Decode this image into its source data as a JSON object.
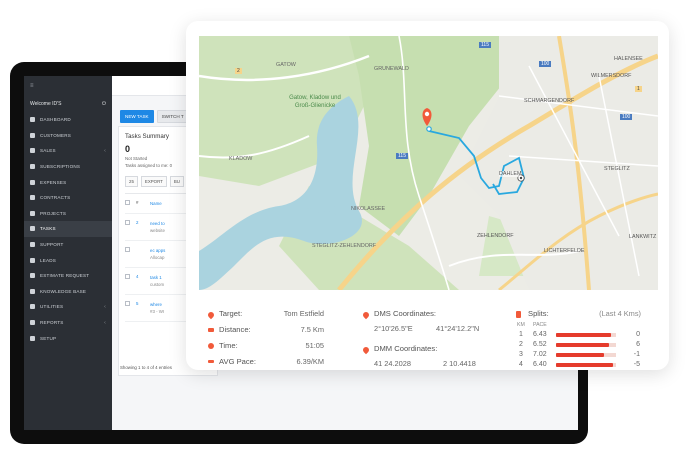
{
  "app": {
    "sidebar": {
      "user": "Welcome ID'S",
      "items": [
        {
          "label": "Dashboard",
          "chevron": false
        },
        {
          "label": "Customers",
          "chevron": false
        },
        {
          "label": "Sales",
          "chevron": true
        },
        {
          "label": "Subscriptions",
          "chevron": false
        },
        {
          "label": "Expenses",
          "chevron": false
        },
        {
          "label": "Contracts",
          "chevron": false
        },
        {
          "label": "Projects",
          "chevron": false
        },
        {
          "label": "Tasks",
          "chevron": false,
          "active": true
        },
        {
          "label": "Support",
          "chevron": false
        },
        {
          "label": "Leads",
          "chevron": false
        },
        {
          "label": "Estimate Request",
          "chevron": false
        },
        {
          "label": "Knowledge Base",
          "chevron": false
        },
        {
          "label": "Utilities",
          "chevron": true
        },
        {
          "label": "Reports",
          "chevron": true
        },
        {
          "label": "Setup",
          "chevron": false
        }
      ]
    },
    "toolbar": {
      "new_task": "NEW TASK",
      "switch": "SWITCH T"
    },
    "summary": {
      "title": "Tasks Summary",
      "count": "0",
      "status": "Not Started",
      "assigned": "Tasks assigned to me: 0"
    },
    "table": {
      "page_size": "25",
      "export": "EXPORT",
      "other": "BU",
      "header_num": "#",
      "header_name": "Name",
      "rows": [
        {
          "num": "2",
          "name": "need to",
          "sub": "website"
        },
        {
          "num": "",
          "name": "ec apps",
          "sub": "Allocap"
        },
        {
          "num": "4",
          "name": "task 1",
          "sub": "custom"
        },
        {
          "num": "5",
          "name": "where",
          "sub": "#3 - WI"
        }
      ],
      "footer": "Showing 1 to 4 of 4 entries"
    }
  },
  "map": {
    "labels": {
      "gatow": "GATOW",
      "grunewald": "GRUNEWALD",
      "halensee": "HALENSEE",
      "wilmersdorf": "WILMERSDORF",
      "park": "Gatow, Kladow und Groß-Glienicke",
      "schmargendorf": "SCHMARGENDORF",
      "kladow": "KLADOW",
      "steglitz": "STEGLITZ",
      "nikolassee": "NIKOLASSEE",
      "dahlem": "DAHLEM",
      "zehlendorf": "ZEHLENDORF",
      "steglitz_zehlendorf": "STEGLITZ-ZEHLENDORF",
      "lichterfelde": "LICHTERFELDE",
      "lankwitz": "LANKWITZ",
      "shield_115": "115",
      "shield_100": "100",
      "shield_1": "1",
      "shield_2": "2"
    }
  },
  "stats": {
    "target_label": "Target:",
    "target_value": "Tom Estfield",
    "distance_label": "Distance:",
    "distance_value": "7.5 Km",
    "time_label": "Time:",
    "time_value": "51:05",
    "pace_label": "AVG Pace:",
    "pace_value": "6.39/KM",
    "dms_label": "DMS Coordinates:",
    "dms_lat": "2°10'26.5\"E",
    "dms_lon": "41°24'12.2\"N",
    "dmm_label": "DMM Coordinates:",
    "dmm_lat": "41 24.2028",
    "dmm_lon": "2 10.4418",
    "splits_label": "Splits:",
    "splits_note": "(Last 4 Kms)",
    "col_km": "KM",
    "col_pace": "PACE",
    "splits": [
      {
        "km": "1",
        "pace": "6.43",
        "fill": 0.92,
        "diff": "0"
      },
      {
        "km": "2",
        "pace": "6.52",
        "fill": 0.88,
        "diff": "6"
      },
      {
        "km": "3",
        "pace": "7.02",
        "fill": 0.8,
        "diff": "-1"
      },
      {
        "km": "4",
        "pace": "6.40",
        "fill": 0.95,
        "diff": "-5"
      }
    ]
  },
  "colors": {
    "accent": "#f15a3a",
    "route": "#29a8df",
    "water": "#aad3df",
    "park": "#c8dfb0"
  }
}
